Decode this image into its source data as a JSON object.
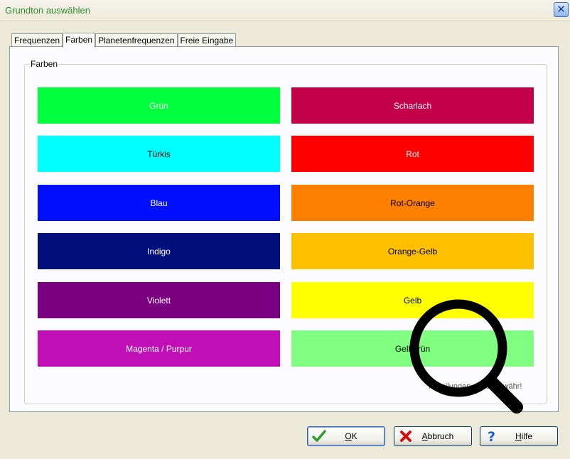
{
  "window": {
    "title": "Grundton auswählen",
    "close_symbol": "✕"
  },
  "tabs": [
    {
      "label": "Frequenzen",
      "active": false
    },
    {
      "label": "Farben",
      "active": true
    },
    {
      "label": "Planetenfrequenzen",
      "active": false
    },
    {
      "label": "Freie Eingabe",
      "active": false
    }
  ],
  "group": {
    "label": "Farben"
  },
  "colors": {
    "left": [
      {
        "label": "Grün",
        "bg": "#00ff3c",
        "fg": "#ffffff"
      },
      {
        "label": "Türkis",
        "bg": "#00ffff",
        "fg": "#000000"
      },
      {
        "label": "Blau",
        "bg": "#0010ff",
        "fg": "#ffffff"
      },
      {
        "label": "Indigo",
        "bg": "#030f7b",
        "fg": "#ffffff"
      },
      {
        "label": "Violett",
        "bg": "#7a0081",
        "fg": "#ffffff"
      },
      {
        "label": "Magenta / Purpur",
        "bg": "#c00fb6",
        "fg": "#ffffff"
      }
    ],
    "right": [
      {
        "label": "Scharlach",
        "bg": "#c2004a",
        "fg": "#ffffff"
      },
      {
        "label": "Rot",
        "bg": "#ff0000",
        "fg": "#ffffff"
      },
      {
        "label": "Rot-Orange",
        "bg": "#ff7f00",
        "fg": "#000000"
      },
      {
        "label": "Orange-Gelb",
        "bg": "#ffc000",
        "fg": "#000000"
      },
      {
        "label": "Gelb",
        "bg": "#ffff00",
        "fg": "#000000"
      },
      {
        "label": "Gelbgrün",
        "bg": "#80ff80",
        "fg": "#000000"
      }
    ]
  },
  "hint_text": "Mitteilungen ohne Gewähr!",
  "buttons": {
    "ok": "OK",
    "cancel": "Abbruch",
    "help": "Hilfe"
  },
  "icons": {
    "ok": "checkmark-icon",
    "cancel": "x-icon",
    "help": "question-icon",
    "overlay": "magnifier-icon"
  }
}
